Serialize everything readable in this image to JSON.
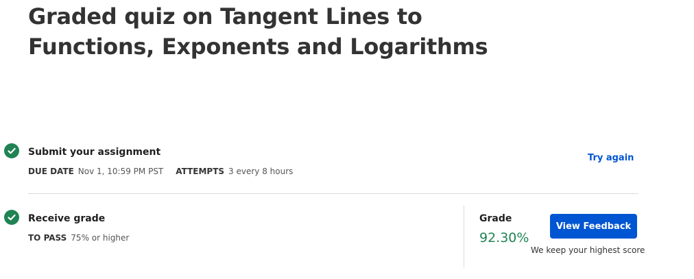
{
  "quiz": {
    "title": "Graded quiz on Tangent Lines to Functions, Exponents and Logarithms"
  },
  "submit": {
    "title": "Submit your assignment",
    "due_label": "DUE DATE",
    "due_value": "Nov 1, 10:59 PM PST",
    "attempts_label": "ATTEMPTS",
    "attempts_value": "3 every 8 hours",
    "try_again_label": "Try again",
    "status_icon": "check-circle-icon"
  },
  "receive": {
    "title": "Receive grade",
    "to_pass_label": "TO PASS",
    "to_pass_value": "75% or higher",
    "status_icon": "check-circle-icon"
  },
  "grade": {
    "label": "Grade",
    "value": "92.30%",
    "button_label": "View Feedback",
    "note": "We keep your highest score"
  },
  "colors": {
    "success": "#1f8354",
    "primary": "#0056d2",
    "divider": "#dadada"
  }
}
